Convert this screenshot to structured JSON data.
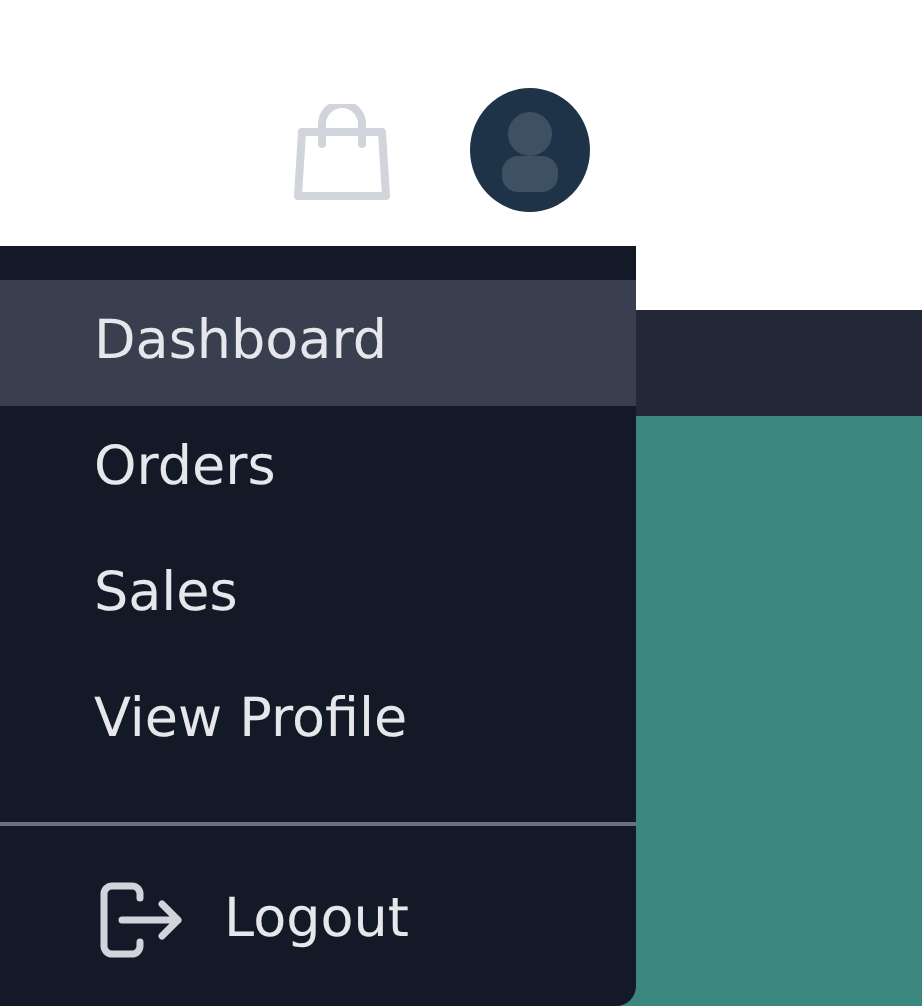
{
  "menu": {
    "items": [
      {
        "label": "Dashboard",
        "selected": true
      },
      {
        "label": "Orders",
        "selected": false
      },
      {
        "label": "Sales",
        "selected": false
      },
      {
        "label": "View Profile",
        "selected": false
      }
    ],
    "logout": {
      "label": "Logout"
    }
  }
}
